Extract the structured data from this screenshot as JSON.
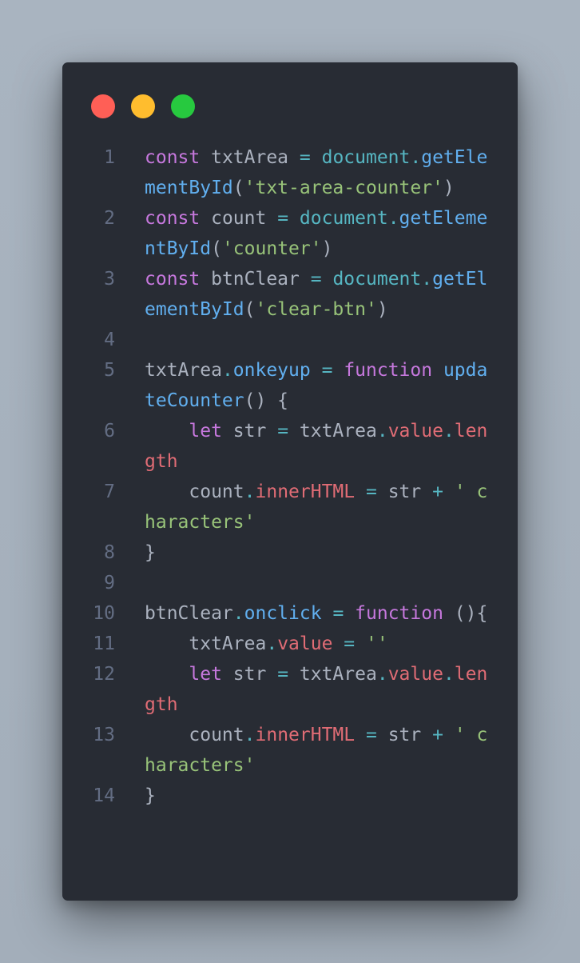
{
  "window": {
    "buttons": [
      "close",
      "minimize",
      "maximize"
    ],
    "colors": {
      "background": "#282c34",
      "close": "#ff5f56",
      "minimize": "#ffbd2e",
      "maximize": "#27c93f"
    }
  },
  "code": {
    "language": "javascript",
    "lines": [
      {
        "number": "1",
        "tokens": [
          {
            "t": "const",
            "k": "kw"
          },
          {
            "t": " txtArea ",
            "k": "id"
          },
          {
            "t": "=",
            "k": "op"
          },
          {
            "t": " ",
            "k": "id"
          },
          {
            "t": "document",
            "k": "obj"
          },
          {
            "t": ".",
            "k": "op"
          },
          {
            "t": "getElementById",
            "k": "fn"
          },
          {
            "t": "(",
            "k": "pn"
          },
          {
            "t": "'txt-area-counter'",
            "k": "str"
          },
          {
            "t": ")",
            "k": "pn"
          }
        ]
      },
      {
        "number": "2",
        "tokens": [
          {
            "t": "const",
            "k": "kw"
          },
          {
            "t": " count ",
            "k": "id"
          },
          {
            "t": "=",
            "k": "op"
          },
          {
            "t": " ",
            "k": "id"
          },
          {
            "t": "document",
            "k": "obj"
          },
          {
            "t": ".",
            "k": "op"
          },
          {
            "t": "getElementById",
            "k": "fn"
          },
          {
            "t": "(",
            "k": "pn"
          },
          {
            "t": "'counter'",
            "k": "str"
          },
          {
            "t": ")",
            "k": "pn"
          }
        ]
      },
      {
        "number": "3",
        "tokens": [
          {
            "t": "const",
            "k": "kw"
          },
          {
            "t": " btnClear ",
            "k": "id"
          },
          {
            "t": "=",
            "k": "op"
          },
          {
            "t": " ",
            "k": "id"
          },
          {
            "t": "document",
            "k": "obj"
          },
          {
            "t": ".",
            "k": "op"
          },
          {
            "t": "getElementById",
            "k": "fn"
          },
          {
            "t": "(",
            "k": "pn"
          },
          {
            "t": "'clear-btn'",
            "k": "str"
          },
          {
            "t": ")",
            "k": "pn"
          }
        ]
      },
      {
        "number": "4",
        "tokens": []
      },
      {
        "number": "5",
        "tokens": [
          {
            "t": "txtArea",
            "k": "id"
          },
          {
            "t": ".",
            "k": "op"
          },
          {
            "t": "onkeyup",
            "k": "fn"
          },
          {
            "t": " ",
            "k": "id"
          },
          {
            "t": "=",
            "k": "op"
          },
          {
            "t": " ",
            "k": "id"
          },
          {
            "t": "function",
            "k": "kw"
          },
          {
            "t": " ",
            "k": "id"
          },
          {
            "t": "updateCounter",
            "k": "fn"
          },
          {
            "t": "() {",
            "k": "pn"
          }
        ]
      },
      {
        "number": "6",
        "tokens": [
          {
            "t": "    ",
            "k": "id"
          },
          {
            "t": "let",
            "k": "kw"
          },
          {
            "t": " str ",
            "k": "id"
          },
          {
            "t": "=",
            "k": "op"
          },
          {
            "t": " txtArea",
            "k": "id"
          },
          {
            "t": ".",
            "k": "op"
          },
          {
            "t": "value",
            "k": "prop"
          },
          {
            "t": ".",
            "k": "op"
          },
          {
            "t": "length",
            "k": "prop"
          }
        ]
      },
      {
        "number": "7",
        "tokens": [
          {
            "t": "    count",
            "k": "id"
          },
          {
            "t": ".",
            "k": "op"
          },
          {
            "t": "innerHTML",
            "k": "prop"
          },
          {
            "t": " ",
            "k": "id"
          },
          {
            "t": "=",
            "k": "op"
          },
          {
            "t": " str ",
            "k": "id"
          },
          {
            "t": "+",
            "k": "op"
          },
          {
            "t": " ",
            "k": "id"
          },
          {
            "t": "' characters'",
            "k": "str"
          }
        ]
      },
      {
        "number": "8",
        "tokens": [
          {
            "t": "}",
            "k": "pn"
          }
        ]
      },
      {
        "number": "9",
        "tokens": []
      },
      {
        "number": "10",
        "tokens": [
          {
            "t": "btnClear",
            "k": "id"
          },
          {
            "t": ".",
            "k": "op"
          },
          {
            "t": "onclick",
            "k": "fn"
          },
          {
            "t": " ",
            "k": "id"
          },
          {
            "t": "=",
            "k": "op"
          },
          {
            "t": " ",
            "k": "id"
          },
          {
            "t": "function",
            "k": "kw"
          },
          {
            "t": " ",
            "k": "id"
          },
          {
            "t": "(){",
            "k": "pn"
          }
        ]
      },
      {
        "number": "11",
        "tokens": [
          {
            "t": "    txtArea",
            "k": "id"
          },
          {
            "t": ".",
            "k": "op"
          },
          {
            "t": "value",
            "k": "prop"
          },
          {
            "t": " ",
            "k": "id"
          },
          {
            "t": "=",
            "k": "op"
          },
          {
            "t": " ",
            "k": "id"
          },
          {
            "t": "''",
            "k": "str"
          }
        ]
      },
      {
        "number": "12",
        "tokens": [
          {
            "t": "    ",
            "k": "id"
          },
          {
            "t": "let",
            "k": "kw"
          },
          {
            "t": " str ",
            "k": "id"
          },
          {
            "t": "=",
            "k": "op"
          },
          {
            "t": " txtArea",
            "k": "id"
          },
          {
            "t": ".",
            "k": "op"
          },
          {
            "t": "value",
            "k": "prop"
          },
          {
            "t": ".",
            "k": "op"
          },
          {
            "t": "length",
            "k": "prop"
          }
        ]
      },
      {
        "number": "13",
        "tokens": [
          {
            "t": "    count",
            "k": "id"
          },
          {
            "t": ".",
            "k": "op"
          },
          {
            "t": "innerHTML",
            "k": "prop"
          },
          {
            "t": " ",
            "k": "id"
          },
          {
            "t": "=",
            "k": "op"
          },
          {
            "t": " str ",
            "k": "id"
          },
          {
            "t": "+",
            "k": "op"
          },
          {
            "t": " ",
            "k": "id"
          },
          {
            "t": "' characters'",
            "k": "str"
          }
        ]
      },
      {
        "number": "14",
        "tokens": [
          {
            "t": "}",
            "k": "pn"
          }
        ]
      }
    ]
  }
}
